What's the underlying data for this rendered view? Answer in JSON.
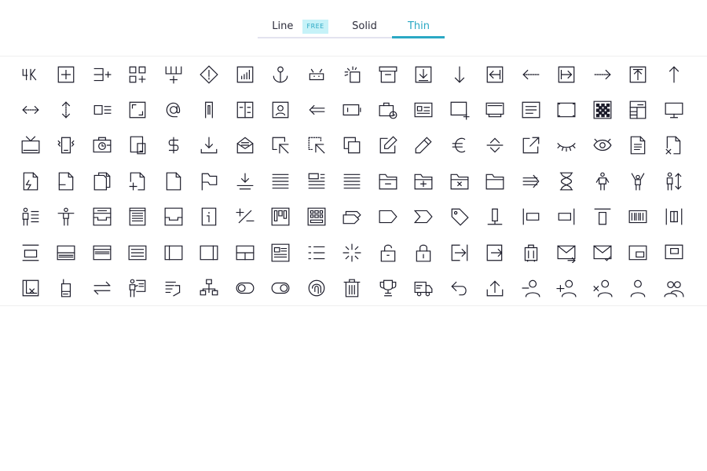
{
  "tabs": [
    {
      "label": "Line",
      "badge": "FREE",
      "active": false
    },
    {
      "label": "Solid",
      "active": false
    },
    {
      "label": "Thin",
      "active": true
    }
  ],
  "accent_color": "#2aa8c4",
  "icons": [
    "4k",
    "add-square",
    "add-list",
    "add-grid",
    "add-column",
    "alert-diamond",
    "analytics-chart",
    "anchor",
    "android",
    "animation",
    "archive-box",
    "arrow-down-box",
    "arrow-down",
    "arrow-left-box",
    "arrow-left-dotted",
    "arrow-right-box",
    "arrow-right-dotted",
    "arrow-up-box",
    "arrow-up",
    "arrows-horizontal",
    "arrows-vertical",
    "align-left",
    "aspect-ratio",
    "at-sign",
    "attachment",
    "layout-columns",
    "contact-book",
    "arrow-left-double",
    "battery",
    "briefcase-clock",
    "id-card",
    "screen-add",
    "monitor",
    "text-document",
    "rectangle",
    "checkerboard",
    "calculator",
    "desktop",
    "tv",
    "phone-vibrate",
    "camera-clock",
    "devices",
    "dollar",
    "download-tray",
    "mail-open",
    "selection-cursor",
    "dotted-cursor",
    "copy",
    "edit-box",
    "pencil",
    "euro",
    "expand-vertical",
    "external-link",
    "eye-closed",
    "eye",
    "file-text",
    "file-x",
    "file-lightning",
    "file-minus",
    "files",
    "file-add",
    "file",
    "flag",
    "download-line",
    "text-lines",
    "text-block",
    "text-align",
    "folder-minus",
    "folder-add",
    "folder-x",
    "folder",
    "arrow-right-lines",
    "hourglass",
    "person",
    "person-arms-up",
    "person-arrows",
    "person-list",
    "person-stand",
    "inbox-tray",
    "newspaper",
    "inbox",
    "info-box",
    "plus-minus",
    "kanban",
    "keyboard",
    "labels",
    "tag-pentagon",
    "tag-arrow",
    "price-tag",
    "lamp",
    "align-left-bar",
    "align-right-bar",
    "align-top-bar",
    "barcode",
    "align-center-bars",
    "align-bottom-bar",
    "layout-bottom",
    "layout-top",
    "list-lines",
    "layout-left",
    "layout-right",
    "layout-split",
    "newsletter",
    "bulleted-list",
    "loader",
    "lock-open",
    "lock",
    "login",
    "logout",
    "luggage",
    "mail-send",
    "mail-check",
    "picture-in-picture",
    "window",
    "note-x",
    "mobile",
    "arrows-swap",
    "presentation",
    "text-return",
    "network",
    "toggle-off",
    "toggle-on",
    "fingerprint",
    "trash",
    "trophy",
    "truck",
    "undo",
    "upload",
    "user-minus",
    "user-add",
    "user-x",
    "user",
    "users"
  ]
}
